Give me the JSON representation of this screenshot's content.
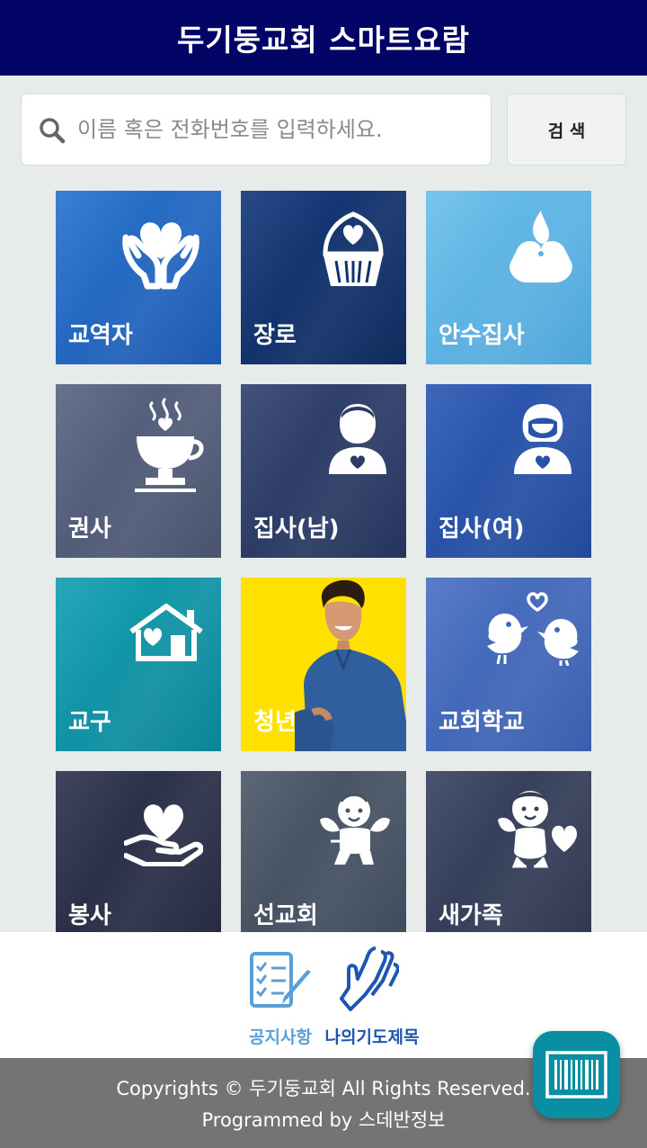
{
  "header": {
    "title": "두기둥교회 스마트요람"
  },
  "search": {
    "placeholder": "이름 혹은 전화번호를 입력하세요.",
    "button_label": "검 색",
    "icon": "search-icon"
  },
  "tiles": [
    {
      "label": "교역자",
      "icon": "heart-hands-icon",
      "color": "#1f62bd"
    },
    {
      "label": "장로",
      "icon": "cupcake-heart-icon",
      "color": "#12306b"
    },
    {
      "label": "안수집사",
      "icon": "candle-heart-icon",
      "color": "#5bb3e1"
    },
    {
      "label": "권사",
      "icon": "coffee-cup-icon",
      "color": "#505b78"
    },
    {
      "label": "집사(남)",
      "icon": "man-heart-icon",
      "color": "#2b3b66"
    },
    {
      "label": "집사(여)",
      "icon": "woman-heart-icon",
      "color": "#2852a8"
    },
    {
      "label": "교구",
      "icon": "house-heart-icon",
      "color": "#0d91a3"
    },
    {
      "label": "청년",
      "icon": "young-man-photo",
      "color": "#ffe100"
    },
    {
      "label": "교회학교",
      "icon": "love-birds-icon",
      "color": "#4468bc"
    },
    {
      "label": "봉사",
      "icon": "hand-heart-icon",
      "color": "#2a2f48"
    },
    {
      "label": "선교회",
      "icon": "cupid-icon",
      "color": "#475363"
    },
    {
      "label": "새가족",
      "icon": "cherub-heart-icon",
      "color": "#353e57"
    }
  ],
  "bottom_nav": [
    {
      "label": "공지사항",
      "icon": "notice-board-icon",
      "color": "#5aa0d6"
    },
    {
      "label": "나의기도제목",
      "icon": "praying-hands-icon",
      "color": "#1f55b3"
    }
  ],
  "footer": {
    "line1": "Copyrights © 두기둥교회 All Rights Reserved.",
    "line2": "Programmed by 스데반정보"
  },
  "fab": {
    "icon": "barcode-icon",
    "color": "#0a8ea3"
  }
}
